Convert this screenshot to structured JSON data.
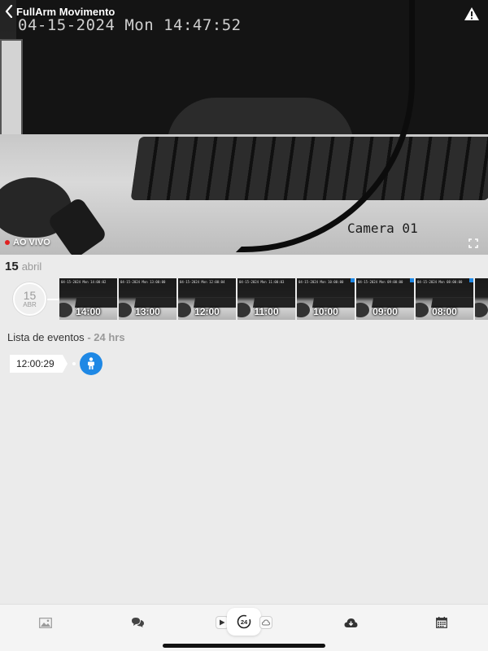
{
  "header": {
    "title": "FullArm Movimento",
    "back_icon": "chevron-left-icon",
    "warning_icon": "warning-triangle-icon"
  },
  "video": {
    "osd_timestamp": "04-15-2024 Mon 14:47:52",
    "osd_camera": "Camera 01",
    "live_label": "AO VIVO",
    "live_color": "#e02020",
    "fullscreen_icon": "fullscreen-icon"
  },
  "day": {
    "number": "15",
    "month": "abril"
  },
  "timeline": {
    "badge_day": "15",
    "badge_month": "ABR",
    "thumbnails": [
      {
        "label": "14:00",
        "stamp": "04-15-2024 Mon 14:00:02",
        "marked": false
      },
      {
        "label": "13:00",
        "stamp": "04-15-2024 Mon 13:00:00",
        "marked": false
      },
      {
        "label": "12:00",
        "stamp": "04-15-2024 Mon 12:00:04",
        "marked": false
      },
      {
        "label": "11:00",
        "stamp": "04-15-2024 Mon 11:00:03",
        "marked": false
      },
      {
        "label": "10:00",
        "stamp": "04-15-2024 Mon 10:00:00",
        "marked": true
      },
      {
        "label": "09:00",
        "stamp": "04-15-2024 Mon 09:00:00",
        "marked": true
      },
      {
        "label": "08:00",
        "stamp": "04-15-2024 Mon 08:00:00",
        "marked": true
      },
      {
        "label": "",
        "stamp": "",
        "marked": false
      }
    ]
  },
  "events": {
    "title": "Lista de eventos",
    "span": "- 24 hrs",
    "items": [
      {
        "time": "12:00:29",
        "icon": "person-icon"
      }
    ]
  },
  "colors": {
    "accent": "#1e88e5",
    "background": "#ebebeb"
  },
  "bottom_bar": {
    "tabs": [
      {
        "icon": "image-icon"
      },
      {
        "icon": "chat-icon"
      },
      {
        "icon": "play-icon"
      },
      {
        "icon": "24h-playback-icon",
        "selected": true
      },
      {
        "icon": "cloud-icon"
      },
      {
        "icon": "cloud-download-icon"
      },
      {
        "icon": "calendar-icon"
      }
    ]
  }
}
